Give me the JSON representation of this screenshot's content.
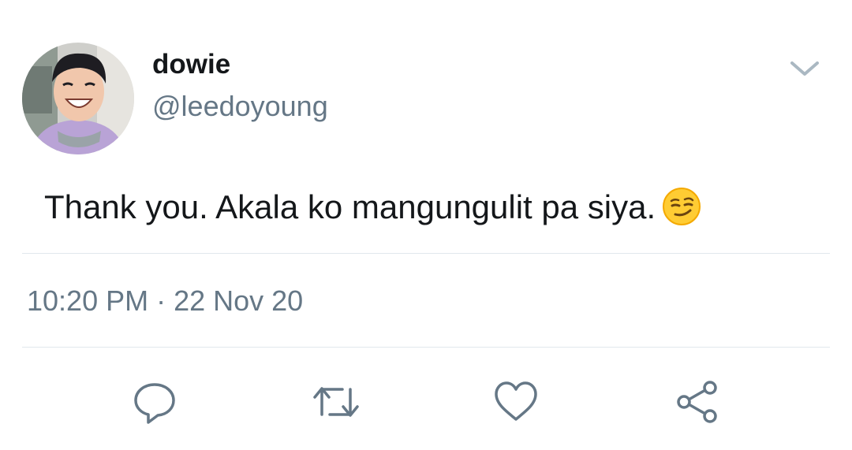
{
  "user": {
    "display_name": "dowie",
    "handle": "@leedoyoung",
    "avatar_icon": "profile-photo"
  },
  "tweet": {
    "text": "Thank you. Akala ko mangungulit pa siya.",
    "emoji": "smirking-face-emoji",
    "timestamp": "10:20 PM · 22 Nov 20"
  },
  "actions": [
    {
      "name": "reply",
      "icon": "comment-icon"
    },
    {
      "name": "retweet",
      "icon": "retweet-icon"
    },
    {
      "name": "like",
      "icon": "heart-icon"
    },
    {
      "name": "share",
      "icon": "share-icon"
    }
  ],
  "colors": {
    "text_primary": "#14171a",
    "text_secondary": "#657786",
    "divider": "#e1e8ed",
    "icon": "#657786",
    "chevron": "#aab8c2"
  }
}
